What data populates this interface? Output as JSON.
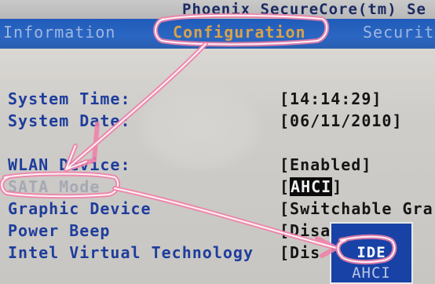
{
  "header": {
    "title": "Phoenix SecureCore(tm) Se"
  },
  "menu": {
    "tabs": [
      {
        "label": "Information"
      },
      {
        "label": "Configuration"
      },
      {
        "label": "Securit"
      }
    ]
  },
  "settings": [
    {
      "label": "System Time:",
      "value": "[14:14:29]"
    },
    {
      "label": "System Date:",
      "value": "[06/11/2010]"
    },
    {
      "label": "WLAN Device:",
      "value": "[Enabled]"
    },
    {
      "label": "SATA Mode",
      "value_open": "[",
      "value_selected": "AHCI",
      "value_close": "]"
    },
    {
      "label": "Graphic Device",
      "value": "[Switchable Gra"
    },
    {
      "label": "Power Beep",
      "value": "[Disa"
    },
    {
      "label": "Intel Virtual Technology",
      "value": "[Dis"
    }
  ],
  "popup": {
    "options": [
      {
        "label": "IDE"
      },
      {
        "label": "AHCI"
      }
    ]
  },
  "colors": {
    "menu_background": "#2a66c2",
    "label_text": "#1e3d9c",
    "active_tab": "#d7a24a",
    "annotation_stroke": "#f07fa8",
    "popup_background": "#1842a6"
  }
}
